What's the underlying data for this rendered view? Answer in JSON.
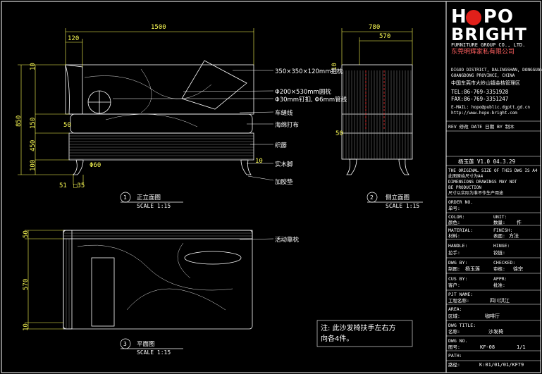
{
  "brand": {
    "name_part1": "H",
    "name_part2": "PO",
    "name_line2": "BRIGHT",
    "group_en": "FURNITURE GROUP CO., LTD.",
    "company_cn": "东莞明辉家私有限公司",
    "addr_en_1": "DIGUO DISTRICT, DALINGSHAN, DONGGUAN",
    "addr_en_2": "GUANGDONG PROVINCE, CHINA",
    "addr_cn": "中国东莞市大岭山镇金桔管理区",
    "tel": "TEL:86-769-3351928",
    "fax": "FAX:86-769-3351247",
    "email": "E-MAIL: hopo@public.dgptt.gd.cn",
    "web": "http://www.hopo-bright.com"
  },
  "titleblock": {
    "rev_header": "REV 修改 DATE 日期 BY 制木",
    "rev_row": "杨玉莲    V1.0    04.3.29",
    "notice_1": "THE ORIGINAL SIZE OF THIS DWG IS A4",
    "notice_2": "此图原始尺寸为A4",
    "notice_3": "DIMENSIONS DRAWINGS MAY NOT",
    "notice_4": "BE PRODUCTION",
    "notice_5": "尺寸以实际为准不作生产用途",
    "order_no_label": "ORDER NO.",
    "order_no_cn": "单号:",
    "color_label": "COLOR:",
    "color_cn": "颜色:",
    "unit_label": "UNIT:",
    "unit_cn": "数量:",
    "unit_value": "件",
    "material_label": "MATERIAL:",
    "material_cn": "材料:",
    "finish_label": "FINISH:",
    "finish_cn": "表面:",
    "finish_value": "方法",
    "handle_label": "HANDLE:",
    "handle_cn": "拉手:",
    "hinge_label": "HINGE:",
    "hinge_cn": "铰链:",
    "dwg_by_label": "DWG BY:",
    "dwg_by_cn": "制图:",
    "dwg_by_value": "杨玉莲",
    "checked_label": "CHECKED:",
    "checked_cn": "审核:",
    "checked_value": "徐宗",
    "cus_by_label": "CUS BY:",
    "cus_by_cn": "客户:",
    "appr_label": "APPR:",
    "appr_cn": "批准:",
    "prj_label": "PJT NAME:",
    "prj_cn": "工程名称:",
    "prj_value": "四川洪江",
    "area_label": "AREA:",
    "area_cn": "区域:",
    "area_value": "咖啡厅",
    "title_label": "DWG TITLE:",
    "title_cn": "名称:",
    "title_value": "沙发椅",
    "dwg_no_label": "DWG NO.",
    "dwg_no_cn": "图号:",
    "dwg_no_value": "KF-08",
    "sheet_value": "1/1",
    "path_label": "PATH:",
    "path_cn": "路径:",
    "path_value": "K:01/01/01/KF79"
  },
  "views": {
    "front": {
      "number": "1",
      "title": "正立面图",
      "scale": "SCALE 1:15"
    },
    "side": {
      "number": "2",
      "title": "侧立面图",
      "scale": "SCALE 1:15"
    },
    "plan": {
      "number": "3",
      "title": "平面图",
      "scale": "SCALE 1:15"
    }
  },
  "dimensions": {
    "front_width": "1500",
    "front_arm": "120",
    "front_height": "850",
    "front_top": "10",
    "front_seat": "150",
    "front_base": "450",
    "front_leg": "100",
    "front_side": "50",
    "front_leg_dia": "60",
    "front_foot_a": "51",
    "front_foot_b": "35",
    "side_depth": "780",
    "side_seat": "570",
    "side_top": "10",
    "side_left": "50",
    "plan_top": "50",
    "plan_mid": "570",
    "plan_bottom": "10"
  },
  "callouts": {
    "c1": "350×350×120mm抱枕",
    "c2": "Φ200×530mm圆枕",
    "c3": "Φ30mm钉扣, Φ6mm管线",
    "c4": "车缝线",
    "c5": "海绵打布",
    "c6": "织藤",
    "c7": "实木脚",
    "c8": "加胶垫",
    "c9": "活动靠枕"
  },
  "note": {
    "line1": "注: 此沙发椅扶手左右方",
    "line2": "向各4件。"
  },
  "colors": {
    "dim": "#ffff55",
    "hatch": "#aaaaaa",
    "line": "#ffffff",
    "accent": "#e0201a"
  }
}
